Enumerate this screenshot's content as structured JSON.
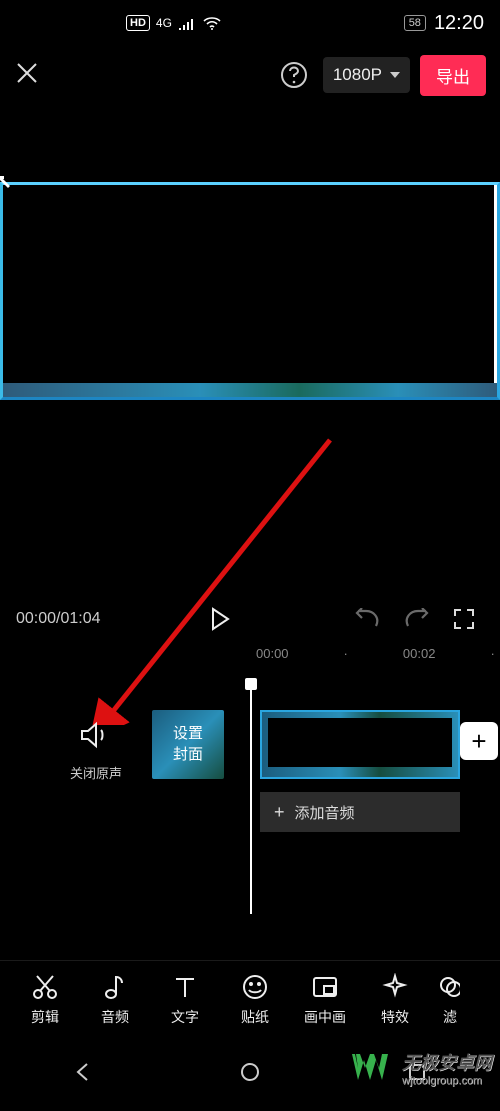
{
  "status": {
    "hd_label": "HD",
    "network_label": "4G",
    "battery_percent": "58",
    "time": "12:20"
  },
  "topbar": {
    "resolution_label": "1080P",
    "export_label": "导出"
  },
  "playback": {
    "current_time": "00:00",
    "duration": "01:04",
    "separator": "/"
  },
  "ruler": {
    "ticks": [
      "00:00",
      "00:02"
    ]
  },
  "timeline": {
    "mute_label": "关闭原声",
    "cover_label": "设置\n封面",
    "add_audio_label": "添加音频",
    "add_clip_label": "+"
  },
  "tools": [
    {
      "name": "edit",
      "label": "剪辑"
    },
    {
      "name": "audio",
      "label": "音频"
    },
    {
      "name": "text",
      "label": "文字"
    },
    {
      "name": "sticker",
      "label": "贴纸"
    },
    {
      "name": "pip",
      "label": "画中画"
    },
    {
      "name": "effects",
      "label": "特效"
    },
    {
      "name": "filter",
      "label": "滤"
    }
  ],
  "watermark": {
    "title": "无极安卓网",
    "url": "wjtoolgroup.com"
  }
}
